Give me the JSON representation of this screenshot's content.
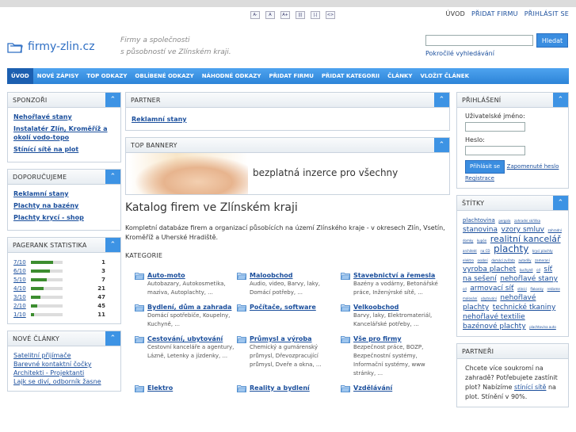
{
  "topbar": {
    "size_buttons": [
      "A-",
      "A",
      "A+",
      "|||",
      "|.|",
      "<>"
    ],
    "links": [
      "ÚVOD",
      "PŘIDAT FIRMU",
      "PŘIHLÁSIT SE"
    ]
  },
  "header": {
    "logo_text": "firmy-zlin.cz",
    "tagline_line1": "Firmy a společnosti",
    "tagline_line2": "s působností ve Zlínském kraji.",
    "search_button": "Hledat",
    "advanced_search": "Pokročilé vyhledávání"
  },
  "nav": [
    "ÚVOD",
    "NOVÉ ZÁPISY",
    "TOP ODKAZY",
    "OBLÍBENÉ ODKAZY",
    "NÁHODNÉ ODKAZY",
    "PŘIDAT FIRMU",
    "PŘIDAT KATEGORII",
    "ČLÁNKY",
    "VLOŽIT ČLÁNEK"
  ],
  "left": {
    "sponzori": {
      "title": "SPONZOŘI",
      "links": [
        "Nehořlavé stany",
        "Instalatér Zlín, Kroměříž a okolí vodo-topo",
        "Stínící sítě na plot"
      ]
    },
    "doporucujeme": {
      "title": "DOPORUČUJEME",
      "links": [
        "Reklamní stany",
        "Plachty na bazény",
        "Plachty krycí - shop"
      ]
    },
    "pagerank": {
      "title": "PAGERANK STATISTIKA",
      "rows": [
        {
          "label": "7/10",
          "count": "1",
          "fill": 0.7
        },
        {
          "label": "6/10",
          "count": "3",
          "fill": 0.6
        },
        {
          "label": "5/10",
          "count": "7",
          "fill": 0.5
        },
        {
          "label": "4/10",
          "count": "21",
          "fill": 0.4
        },
        {
          "label": "3/10",
          "count": "47",
          "fill": 0.3
        },
        {
          "label": "2/10",
          "count": "45",
          "fill": 0.2
        },
        {
          "label": "1/10",
          "count": "11",
          "fill": 0.1
        }
      ]
    },
    "nove_clanky": {
      "title": "NOVÉ ČLÁNKY",
      "links": [
        "Satelitní přijímače",
        "Barevné kontaktní čočky",
        "Architekti - Projektanti",
        "Lajk se diví, odborník žasne"
      ]
    }
  },
  "center": {
    "partner": {
      "title": "PARTNER",
      "link": "Reklamní stany"
    },
    "top_bannery": {
      "title": "TOP BANNERY",
      "banner_text": "bezplatná inzerce pro všechny"
    },
    "heading": "Katalog firem ve Zlínském kraji",
    "intro": "Kompletní databáze firem a organizací působících na území Zlínského kraje - v okresech Zlín, Vsetín, Kroměříž a Uherské Hradiště.",
    "kategorie_label": "KATEGORIE",
    "categories": [
      {
        "title": "Auto-moto",
        "sub": "Autobazary, Autokosmetika, maziva, Autoplachty, ..."
      },
      {
        "title": "Maloobchod",
        "sub": "Audio, video, Barvy, laky, Domácí potřeby, ..."
      },
      {
        "title": "Stavebnictví a řemesla",
        "sub": "Bazény a vodárny, Betonářské práce, Inženýrské sítě, ..."
      },
      {
        "title": "Bydlení, dům a zahrada",
        "sub": "Domácí spotřebiče, Koupelny, Kuchyně, ..."
      },
      {
        "title": "Počítače, software",
        "sub": ""
      },
      {
        "title": "Velkoobchod",
        "sub": "Barvy, laky, Elektromateriál, Kancelářské potřeby, ..."
      },
      {
        "title": "Cestování, ubytování",
        "sub": "Cestovní kanceláře a agentury, Lázně, Letenky a jízdenky, ..."
      },
      {
        "title": "Průmysl a výroba",
        "sub": "Chemický a gumárenský průmysl, Dřevozpracující průmysl, Dveře a okna, ..."
      },
      {
        "title": "Vše pro firmy",
        "sub": "Bezpečnost práce, BOZP, Bezpečnostní systémy, Informační systémy, www stránky, ..."
      },
      {
        "title": "Elektro",
        "sub": ""
      },
      {
        "title": "Reality a bydlení",
        "sub": ""
      },
      {
        "title": "Vzdělávání",
        "sub": ""
      }
    ]
  },
  "right": {
    "prihlaseni": {
      "title": "PŘIHLÁŠENÍ",
      "user_label": "Uživatelské jméno:",
      "pass_label": "Heslo:",
      "login_button": "Přihlásit se",
      "forgot": "Zapomenuté heslo",
      "register": "Registrace"
    },
    "stitky": {
      "title": "ŠTÍTKY",
      "tags": [
        {
          "t": "plachtovina",
          "s": 7
        },
        {
          "t": "pergola",
          "s": 4
        },
        {
          "t": "zahradní skříňka",
          "s": 4
        },
        {
          "t": "stanovina",
          "s": 9
        },
        {
          "t": "vzory smluv",
          "s": 9
        },
        {
          "t": "zahradní domky",
          "s": 4
        },
        {
          "t": "kupón",
          "s": 4
        },
        {
          "t": "realitní kancelář",
          "s": 11
        },
        {
          "t": "architekt",
          "s": 4
        },
        {
          "t": "na CD",
          "s": 4
        },
        {
          "t": "plachty",
          "s": 12
        },
        {
          "t": "krycí plachty",
          "s": 4
        },
        {
          "t": "elektro",
          "s": 4
        },
        {
          "t": "osobní",
          "s": 4
        },
        {
          "t": "domácí zvířata",
          "s": 4
        },
        {
          "t": "autodíly",
          "s": 4
        },
        {
          "t": "zameraní",
          "s": 4
        },
        {
          "t": "vyroba plachet",
          "s": 9
        },
        {
          "t": "kuchyně",
          "s": 4
        },
        {
          "t": "cd",
          "s": 4
        },
        {
          "t": "síť na sešení",
          "s": 9
        },
        {
          "t": "nehořlavé stany",
          "s": 9
        },
        {
          "t": "cd",
          "s": 4
        },
        {
          "t": "armovací síť",
          "s": 9
        },
        {
          "t": "stínící",
          "s": 4
        },
        {
          "t": "flakonky",
          "s": 4
        },
        {
          "t": "reklame",
          "s": 4
        },
        {
          "t": "malování",
          "s": 4
        },
        {
          "t": "ubytování",
          "s": 4
        },
        {
          "t": "nehořlavé plachty",
          "s": 9
        },
        {
          "t": "technické tkaniny",
          "s": 9
        },
        {
          "t": "nehořlavé textilie",
          "s": 9
        },
        {
          "t": "bazénové plachty",
          "s": 9
        },
        {
          "t": "plachtovina auto",
          "s": 4
        }
      ]
    },
    "partneri": {
      "title": "PARTNEŘI",
      "text1": "Chcete více soukromí na zahradě? Potřebujete zastínit plot? Nabízíme",
      "link": "stínící sítě",
      "text2": "na plot. Stínění v 90%."
    }
  },
  "colors": {
    "accent": "#3d93e4",
    "nav": "#2d84d8",
    "link": "#1a4e9c"
  }
}
